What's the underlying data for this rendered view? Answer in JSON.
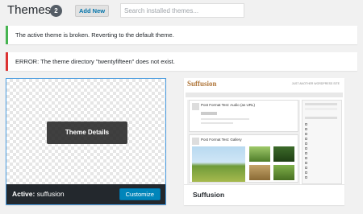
{
  "header": {
    "title": "Themes",
    "count": "2",
    "add_new_label": "Add New",
    "search_placeholder": "Search installed themes..."
  },
  "notices": {
    "success": "The active theme is broken. Reverting to the default theme.",
    "error": "ERROR: The theme directory \"twentyfifteen\" does not exist."
  },
  "active_theme": {
    "details_label": "Theme Details",
    "active_prefix": "Active:",
    "name": "suffusion",
    "customize_label": "Customize"
  },
  "other_theme": {
    "name": "Suffusion",
    "screenshot": {
      "logo": "Suffusion",
      "tagline": "JUST ANOTHER WORDPRESS SITE",
      "post1_title": "Post Format Test: Audio (as URL)",
      "post2_title": "Post Format Test: Gallery"
    }
  },
  "colors": {
    "accent": "#0085ba",
    "success": "#46b450",
    "error": "#dc3232",
    "active_border": "#4b9de0"
  }
}
